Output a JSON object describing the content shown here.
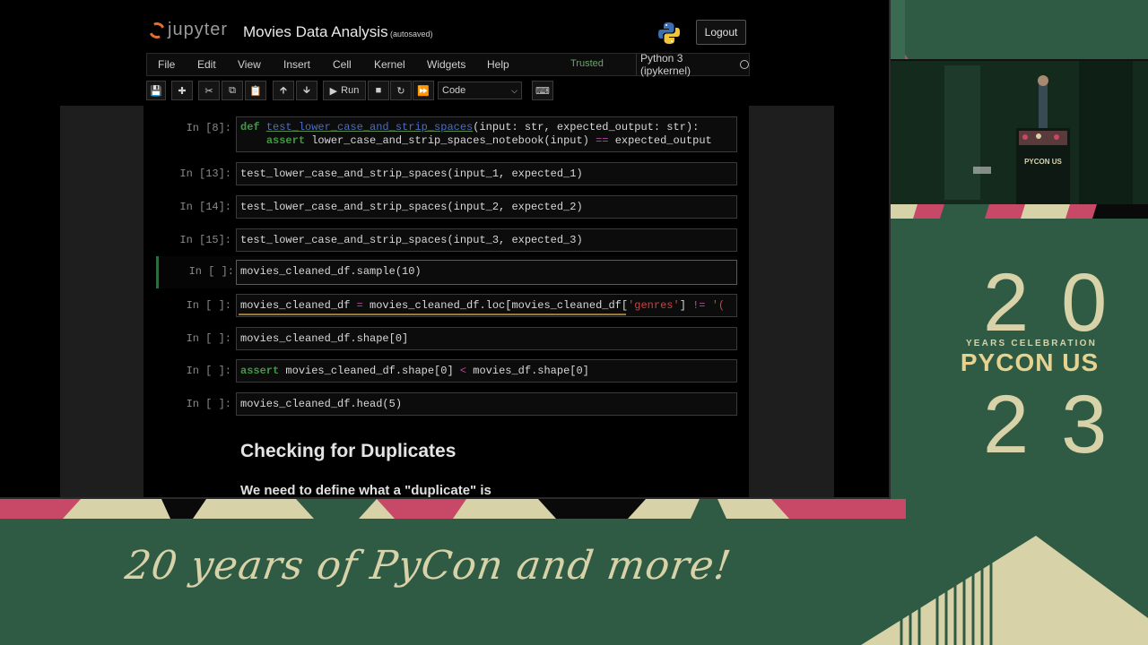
{
  "jupyter": {
    "logo_text": "jupyter",
    "notebook_title": "Movies Data Analysis",
    "autosave_status": "(autosaved)",
    "logout_label": "Logout",
    "menu": [
      "File",
      "Edit",
      "View",
      "Insert",
      "Cell",
      "Kernel",
      "Widgets",
      "Help"
    ],
    "trusted_label": "Trusted",
    "kernel_name": "Python 3 (ipykernel)",
    "toolbar": {
      "run_label": "Run",
      "cell_type": "Code"
    },
    "cells": [
      {
        "prompt": "In [8]:",
        "line1": "def test_lower_case_and_strip_spaces(input: str, expected_output: str):",
        "line2": "    assert lower_case_and_strip_spaces_notebook(input) == expected_output"
      },
      {
        "prompt": "In [13]:",
        "code": "test_lower_case_and_strip_spaces(input_1, expected_1)"
      },
      {
        "prompt": "In [14]:",
        "code": "test_lower_case_and_strip_spaces(input_2, expected_2)"
      },
      {
        "prompt": "In [15]:",
        "code": "test_lower_case_and_strip_spaces(input_3, expected_3)"
      },
      {
        "prompt": "In [ ]:",
        "code": "movies_cleaned_df.sample(10)"
      },
      {
        "prompt": "In [ ]:",
        "code_a": "movies_cleaned_df ",
        "code_op": "=",
        "code_b": " movies_cleaned_df.loc[movies_cleaned_df[",
        "code_str": "'genres'",
        "code_c": "] ",
        "code_op2": "!=",
        "code_str2": " '("
      },
      {
        "prompt": "In [ ]:",
        "code": "movies_cleaned_df.shape[0]"
      },
      {
        "prompt": "In [ ]:",
        "code_kw": "assert",
        "code_a": " movies_cleaned_df.shape[0] ",
        "code_op": "<",
        "code_b": " movies_df.shape[0]"
      },
      {
        "prompt": "In [ ]:",
        "code": "movies_cleaned_df.head(5)"
      }
    ],
    "markdown_heading": "Checking for Duplicates",
    "markdown_paragraph": "We need to define what a \"duplicate\" is"
  },
  "camera": {
    "podium_text": "PYCON US"
  },
  "branding": {
    "year_top": "20",
    "celebration_text": "YEARS CELEBRATION",
    "pycon_text": "PYCON US",
    "year_bottom": "23",
    "tagline": "20 years of PyCon and more!"
  },
  "colors": {
    "background_green": "#2f5a44",
    "cream": "#d8d2a8",
    "gold": "#e8d290",
    "pink": "#c84868"
  }
}
